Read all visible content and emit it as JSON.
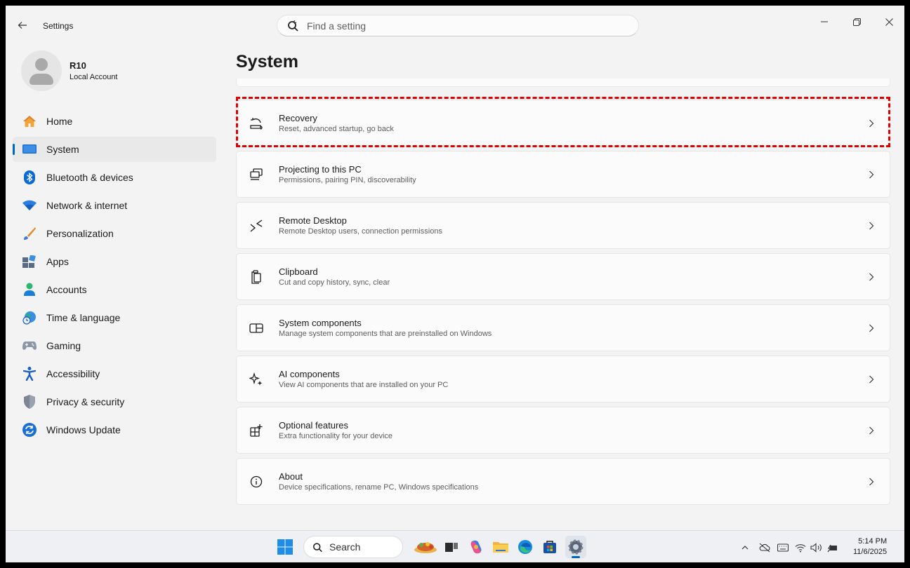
{
  "window": {
    "title": "Settings",
    "search_placeholder": "Find a setting",
    "controls": [
      "minimize-icon",
      "restore-icon",
      "close-icon"
    ]
  },
  "user": {
    "name": "R10",
    "account_type": "Local Account"
  },
  "sidebar": {
    "items": [
      {
        "label": "Home",
        "icon": "home-icon"
      },
      {
        "label": "System",
        "icon": "system-icon",
        "active": true
      },
      {
        "label": "Bluetooth & devices",
        "icon": "bluetooth-icon"
      },
      {
        "label": "Network & internet",
        "icon": "wifi-icon"
      },
      {
        "label": "Personalization",
        "icon": "brush-icon"
      },
      {
        "label": "Apps",
        "icon": "apps-icon"
      },
      {
        "label": "Accounts",
        "icon": "person-icon"
      },
      {
        "label": "Time & language",
        "icon": "globe-clock-icon"
      },
      {
        "label": "Gaming",
        "icon": "gamepad-icon"
      },
      {
        "label": "Accessibility",
        "icon": "accessibility-icon"
      },
      {
        "label": "Privacy & security",
        "icon": "shield-icon"
      },
      {
        "label": "Windows Update",
        "icon": "update-icon"
      }
    ]
  },
  "main": {
    "title": "System",
    "cards": [
      {
        "title": "Recovery",
        "subtitle": "Reset, advanced startup, go back",
        "icon": "recovery-icon",
        "highlighted": true
      },
      {
        "title": "Projecting to this PC",
        "subtitle": "Permissions, pairing PIN, discoverability",
        "icon": "projecting-icon"
      },
      {
        "title": "Remote Desktop",
        "subtitle": "Remote Desktop users, connection permissions",
        "icon": "remote-desktop-icon"
      },
      {
        "title": "Clipboard",
        "subtitle": "Cut and copy history, sync, clear",
        "icon": "clipboard-icon"
      },
      {
        "title": "System components",
        "subtitle": "Manage system components that are preinstalled on Windows",
        "icon": "system-components-icon"
      },
      {
        "title": "AI components",
        "subtitle": "View AI components that are installed on your PC",
        "icon": "sparkle-icon"
      },
      {
        "title": "Optional features",
        "subtitle": "Extra functionality for your device",
        "icon": "optional-features-icon"
      },
      {
        "title": "About",
        "subtitle": "Device specifications, rename PC, Windows specifications",
        "icon": "info-icon"
      }
    ]
  },
  "taskbar": {
    "search_label": "Search",
    "time": "5:14 PM",
    "date": "11/6/2025"
  },
  "colors": {
    "accent": "#0067c0",
    "highlight_border": "#e00000"
  }
}
